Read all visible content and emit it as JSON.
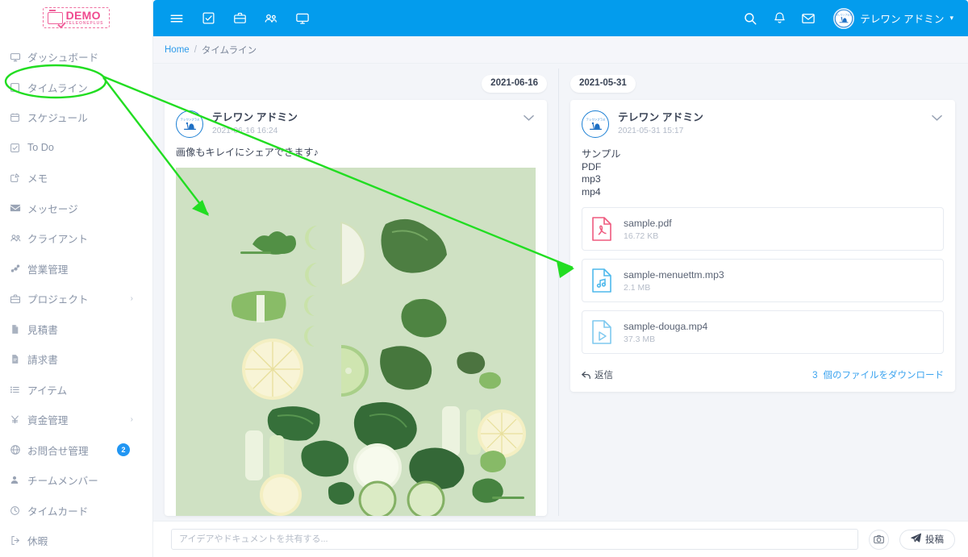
{
  "brand": {
    "logo_demo": "DEMO",
    "logo_sub": "TELEONEPLUS",
    "accent_blue": "#039ced",
    "accent_pink": "#ef4a8f",
    "page_bg": "#f3f5f9"
  },
  "sidebar": {
    "items": [
      {
        "label": "ダッシュボード",
        "icon": "monitor-icon",
        "caret": "",
        "badge": ""
      },
      {
        "label": "タイムライン",
        "icon": "square-icon",
        "caret": "",
        "badge": ""
      },
      {
        "label": "スケジュール",
        "icon": "calendar-icon",
        "caret": "",
        "badge": ""
      },
      {
        "label": "To Do",
        "icon": "check-square-icon",
        "caret": "",
        "badge": ""
      },
      {
        "label": "メモ",
        "icon": "edit-icon",
        "caret": "",
        "badge": ""
      },
      {
        "label": "メッセージ",
        "icon": "envelope-icon",
        "caret": "",
        "badge": ""
      },
      {
        "label": "クライアント",
        "icon": "users-icon",
        "caret": "",
        "badge": ""
      },
      {
        "label": "営業管理",
        "icon": "sitemap-icon",
        "caret": "",
        "badge": ""
      },
      {
        "label": "プロジェクト",
        "icon": "briefcase-icon",
        "caret": "›",
        "badge": ""
      },
      {
        "label": "見積書",
        "icon": "file-icon",
        "caret": "",
        "badge": ""
      },
      {
        "label": "請求書",
        "icon": "invoice-icon",
        "caret": "",
        "badge": ""
      },
      {
        "label": "アイテム",
        "icon": "list-icon",
        "caret": "",
        "badge": ""
      },
      {
        "label": "資金管理",
        "icon": "yen-icon",
        "caret": "›",
        "badge": ""
      },
      {
        "label": "お問合せ管理",
        "icon": "globe-icon",
        "caret": "",
        "badge": "2"
      },
      {
        "label": "チームメンバー",
        "icon": "person-icon",
        "caret": "",
        "badge": ""
      },
      {
        "label": "タイムカード",
        "icon": "clock-icon",
        "caret": "",
        "badge": ""
      },
      {
        "label": "休暇",
        "icon": "logout-icon",
        "caret": "",
        "badge": ""
      }
    ]
  },
  "header": {
    "left_icons": [
      {
        "name": "hamburger-icon"
      },
      {
        "name": "check-square-icon"
      },
      {
        "name": "briefcase-icon"
      },
      {
        "name": "users-icon"
      },
      {
        "name": "monitor-icon"
      }
    ],
    "right_icons": [
      {
        "name": "search-icon"
      },
      {
        "name": "bell-icon"
      },
      {
        "name": "envelope-icon"
      }
    ],
    "user_name": "テレワン アドミン",
    "user_caret": "▾"
  },
  "breadcrumb": {
    "home": "Home",
    "separator": "/",
    "current": "タイムライン"
  },
  "timeline": {
    "left_column": {
      "date_pill": "2021-06-16",
      "post": {
        "author": "テレワン アドミン",
        "time": "2021-06-16 16:24",
        "text": "画像もキレイにシェアできます♪",
        "chevron": "⌄",
        "image_alt": "green vegetables flat lay"
      }
    },
    "right_column": {
      "date_pill": "2021-05-31",
      "post": {
        "author": "テレワン アドミン",
        "time": "2021-05-31 15:17",
        "chevron": "⌄",
        "text_lines": [
          "サンプル",
          "PDF",
          "mp3",
          "mp4"
        ],
        "files": [
          {
            "name": "sample.pdf",
            "size": "16.72 KB",
            "icon": "pdf-file-icon",
            "color": "#ef5a7f"
          },
          {
            "name": "sample-menuettm.mp3",
            "size": "2.1 MB",
            "icon": "audio-file-icon",
            "color": "#4fb9ec"
          },
          {
            "name": "sample-douga.mp4",
            "size": "37.3 MB",
            "icon": "video-file-icon",
            "color": "#7fc9ef"
          }
        ],
        "reply_label": "返信",
        "download_count": "3",
        "download_label": "個のファイルをダウンロード"
      }
    }
  },
  "composer": {
    "placeholder": "アイデアやドキュメントを共有する...",
    "value": "",
    "camera_icon": "camera-icon",
    "post_label": "投稿",
    "post_icon": "paper-plane-icon"
  },
  "annotations": {
    "highlight_target": "タイムライン",
    "color": "#22dd22"
  }
}
